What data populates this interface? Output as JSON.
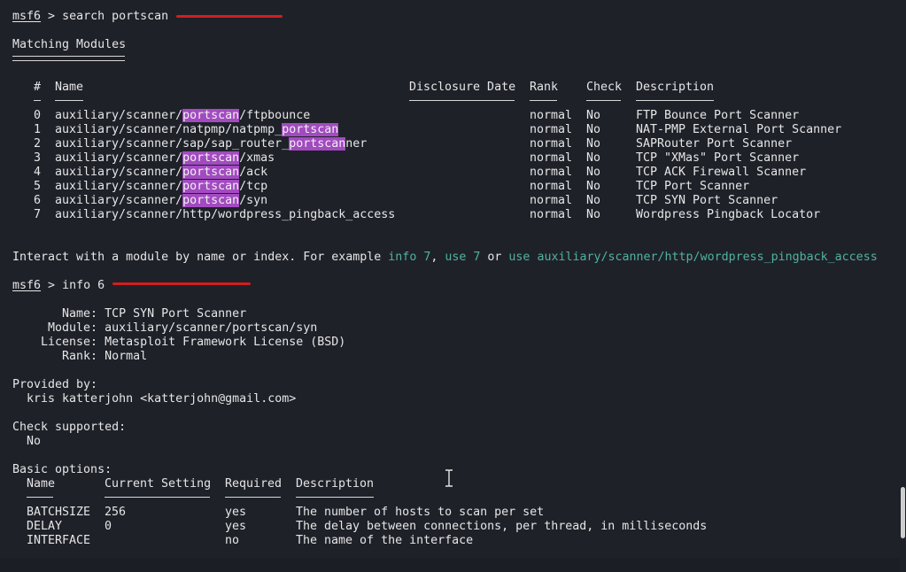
{
  "colors": {
    "background": "#1f2129",
    "text": "#e6e6e6",
    "highlight": "#a24bc0",
    "command_hint": "#4fb3a0",
    "annotation_red": "#d11e1e"
  },
  "prompt1": {
    "prompt": "msf6",
    "sep": " > ",
    "command": "search portscan"
  },
  "matching_title": "Matching Modules",
  "headers": {
    "num": "#",
    "name": "Name",
    "date": "Disclosure Date",
    "rank": "Rank",
    "check": "Check",
    "desc": "Description"
  },
  "modules": [
    {
      "num": "0",
      "pre": "auxiliary/scanner/",
      "hl": "portscan",
      "post": "/ftpbounce",
      "rank": "normal",
      "check": "No",
      "desc": "FTP Bounce Port Scanner"
    },
    {
      "num": "1",
      "pre": "auxiliary/scanner/natpmp/natpmp_",
      "hl": "portscan",
      "post": "",
      "rank": "normal",
      "check": "No",
      "desc": "NAT-PMP External Port Scanner"
    },
    {
      "num": "2",
      "pre": "auxiliary/scanner/sap/sap_router_",
      "hl": "portscan",
      "post": "ner",
      "rank": "normal",
      "check": "No",
      "desc": "SAPRouter Port Scanner"
    },
    {
      "num": "3",
      "pre": "auxiliary/scanner/",
      "hl": "portscan",
      "post": "/xmas",
      "rank": "normal",
      "check": "No",
      "desc": "TCP \"XMas\" Port Scanner"
    },
    {
      "num": "4",
      "pre": "auxiliary/scanner/",
      "hl": "portscan",
      "post": "/ack",
      "rank": "normal",
      "check": "No",
      "desc": "TCP ACK Firewall Scanner"
    },
    {
      "num": "5",
      "pre": "auxiliary/scanner/",
      "hl": "portscan",
      "post": "/tcp",
      "rank": "normal",
      "check": "No",
      "desc": "TCP Port Scanner"
    },
    {
      "num": "6",
      "pre": "auxiliary/scanner/",
      "hl": "portscan",
      "post": "/syn",
      "rank": "normal",
      "check": "No",
      "desc": "TCP SYN Port Scanner"
    },
    {
      "num": "7",
      "pre": "auxiliary/scanner/http/wordpress_pingback_access",
      "hl": "",
      "post": "",
      "rank": "normal",
      "check": "No",
      "desc": "Wordpress Pingback Locator"
    }
  ],
  "interact": {
    "text1": "Interact with a module by name or index. For example ",
    "cmd1": "info 7",
    "text2": ", ",
    "cmd2": "use 7",
    "text3": " or ",
    "cmd3": "use auxiliary/scanner/http/wordpress_pingback_access"
  },
  "prompt2": {
    "prompt": "msf6",
    "sep": " > ",
    "command": "info 6"
  },
  "info": {
    "name_line": "       Name: TCP SYN Port Scanner",
    "module_line": "     Module: auxiliary/scanner/portscan/syn",
    "license_line": "    License: Metasploit Framework License (BSD)",
    "rank_line": "       Rank: Normal"
  },
  "provided_by": {
    "label": "Provided by:",
    "author": "  kris katterjohn <katterjohn@gmail.com>"
  },
  "check_supported": {
    "label": "Check supported:",
    "value": "  No"
  },
  "basic_options": {
    "label": "Basic options:",
    "headers": {
      "name": "Name",
      "setting": "Current Setting",
      "required": "Required",
      "desc": "Description"
    },
    "rows": [
      {
        "name": "BATCHSIZE",
        "setting": "256",
        "required": "yes",
        "desc": "The number of hosts to scan per set"
      },
      {
        "name": "DELAY",
        "setting": "0",
        "required": "yes",
        "desc": "The delay between connections, per thread, in milliseconds"
      },
      {
        "name": "INTERFACE",
        "setting": "",
        "required": "no",
        "desc": "The name of the interface"
      }
    ]
  }
}
